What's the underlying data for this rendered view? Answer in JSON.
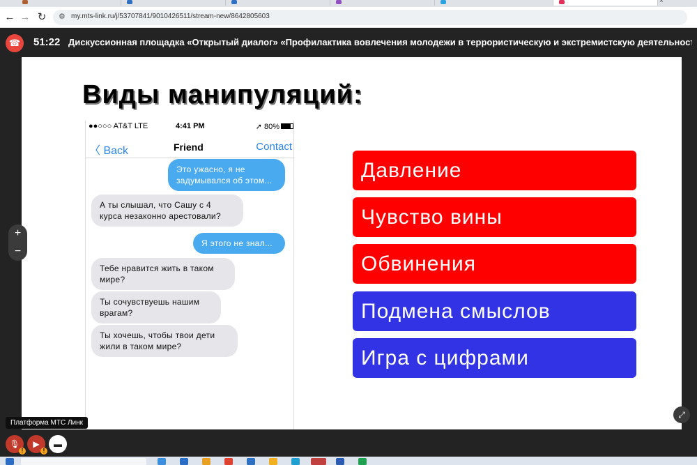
{
  "browser": {
    "url": "my.mts-link.ru/j/53707841/9010426511/stream-new/8642805603",
    "tab_close": "×",
    "back_glyph": "←",
    "forward_glyph": "→",
    "reload_glyph": "↻",
    "url_icon": "⚙"
  },
  "meeting": {
    "hangup_glyph": "☎",
    "timer": "51:22",
    "title": "Дискуссионная площадка «Открытый диалог» «Профилактика вовлечения молодежи в террористическую и экстремистскую деятельность»",
    "zoom_in": "+",
    "zoom_out": "−",
    "expand_glyph": "⤢",
    "tooltip": "Платформа МТС Линк",
    "warn_glyph": "!",
    "mic_glyph": "🎙",
    "cam_glyph": "▶",
    "screen_glyph": "▬"
  },
  "slide": {
    "title": "Виды манипуляций:",
    "phone": {
      "carrier": "●●○○○ AT&T LTE",
      "time": "4:41 PM",
      "battery": "➚ 80%",
      "back": "〈 Back",
      "name": "Friend",
      "contact": "Contact",
      "messages": [
        {
          "text": "Это ужасно, я не задумывался об этом...",
          "side": "out"
        },
        {
          "text": "А ты слышал, что Сашу с 4 курса незаконно арестовали?",
          "side": "in"
        },
        {
          "text": "Я этого не знал...",
          "side": "out"
        },
        {
          "text": "Тебе нравится жить в таком мире?",
          "side": "in"
        },
        {
          "text": "Ты сочувствуешь нашим врагам?",
          "side": "in"
        },
        {
          "text": "Ты хочешь, чтобы твои дети жили в таком мире?",
          "side": "in"
        }
      ]
    },
    "labels": [
      {
        "text": "Давление",
        "color": "#ff0000"
      },
      {
        "text": "Чувство вины",
        "color": "#ff0000"
      },
      {
        "text": "Обвинения",
        "color": "#ff0000"
      },
      {
        "text": "Подмена смыслов",
        "color": "#3333e6"
      },
      {
        "text": "Игра с цифрами",
        "color": "#3333e6"
      }
    ]
  },
  "colors": {
    "hangup": "#e8453c",
    "ctrl_off": "#c0392b",
    "ctrl_white": "#ffffff",
    "accent_blue": "#2a86e8"
  }
}
